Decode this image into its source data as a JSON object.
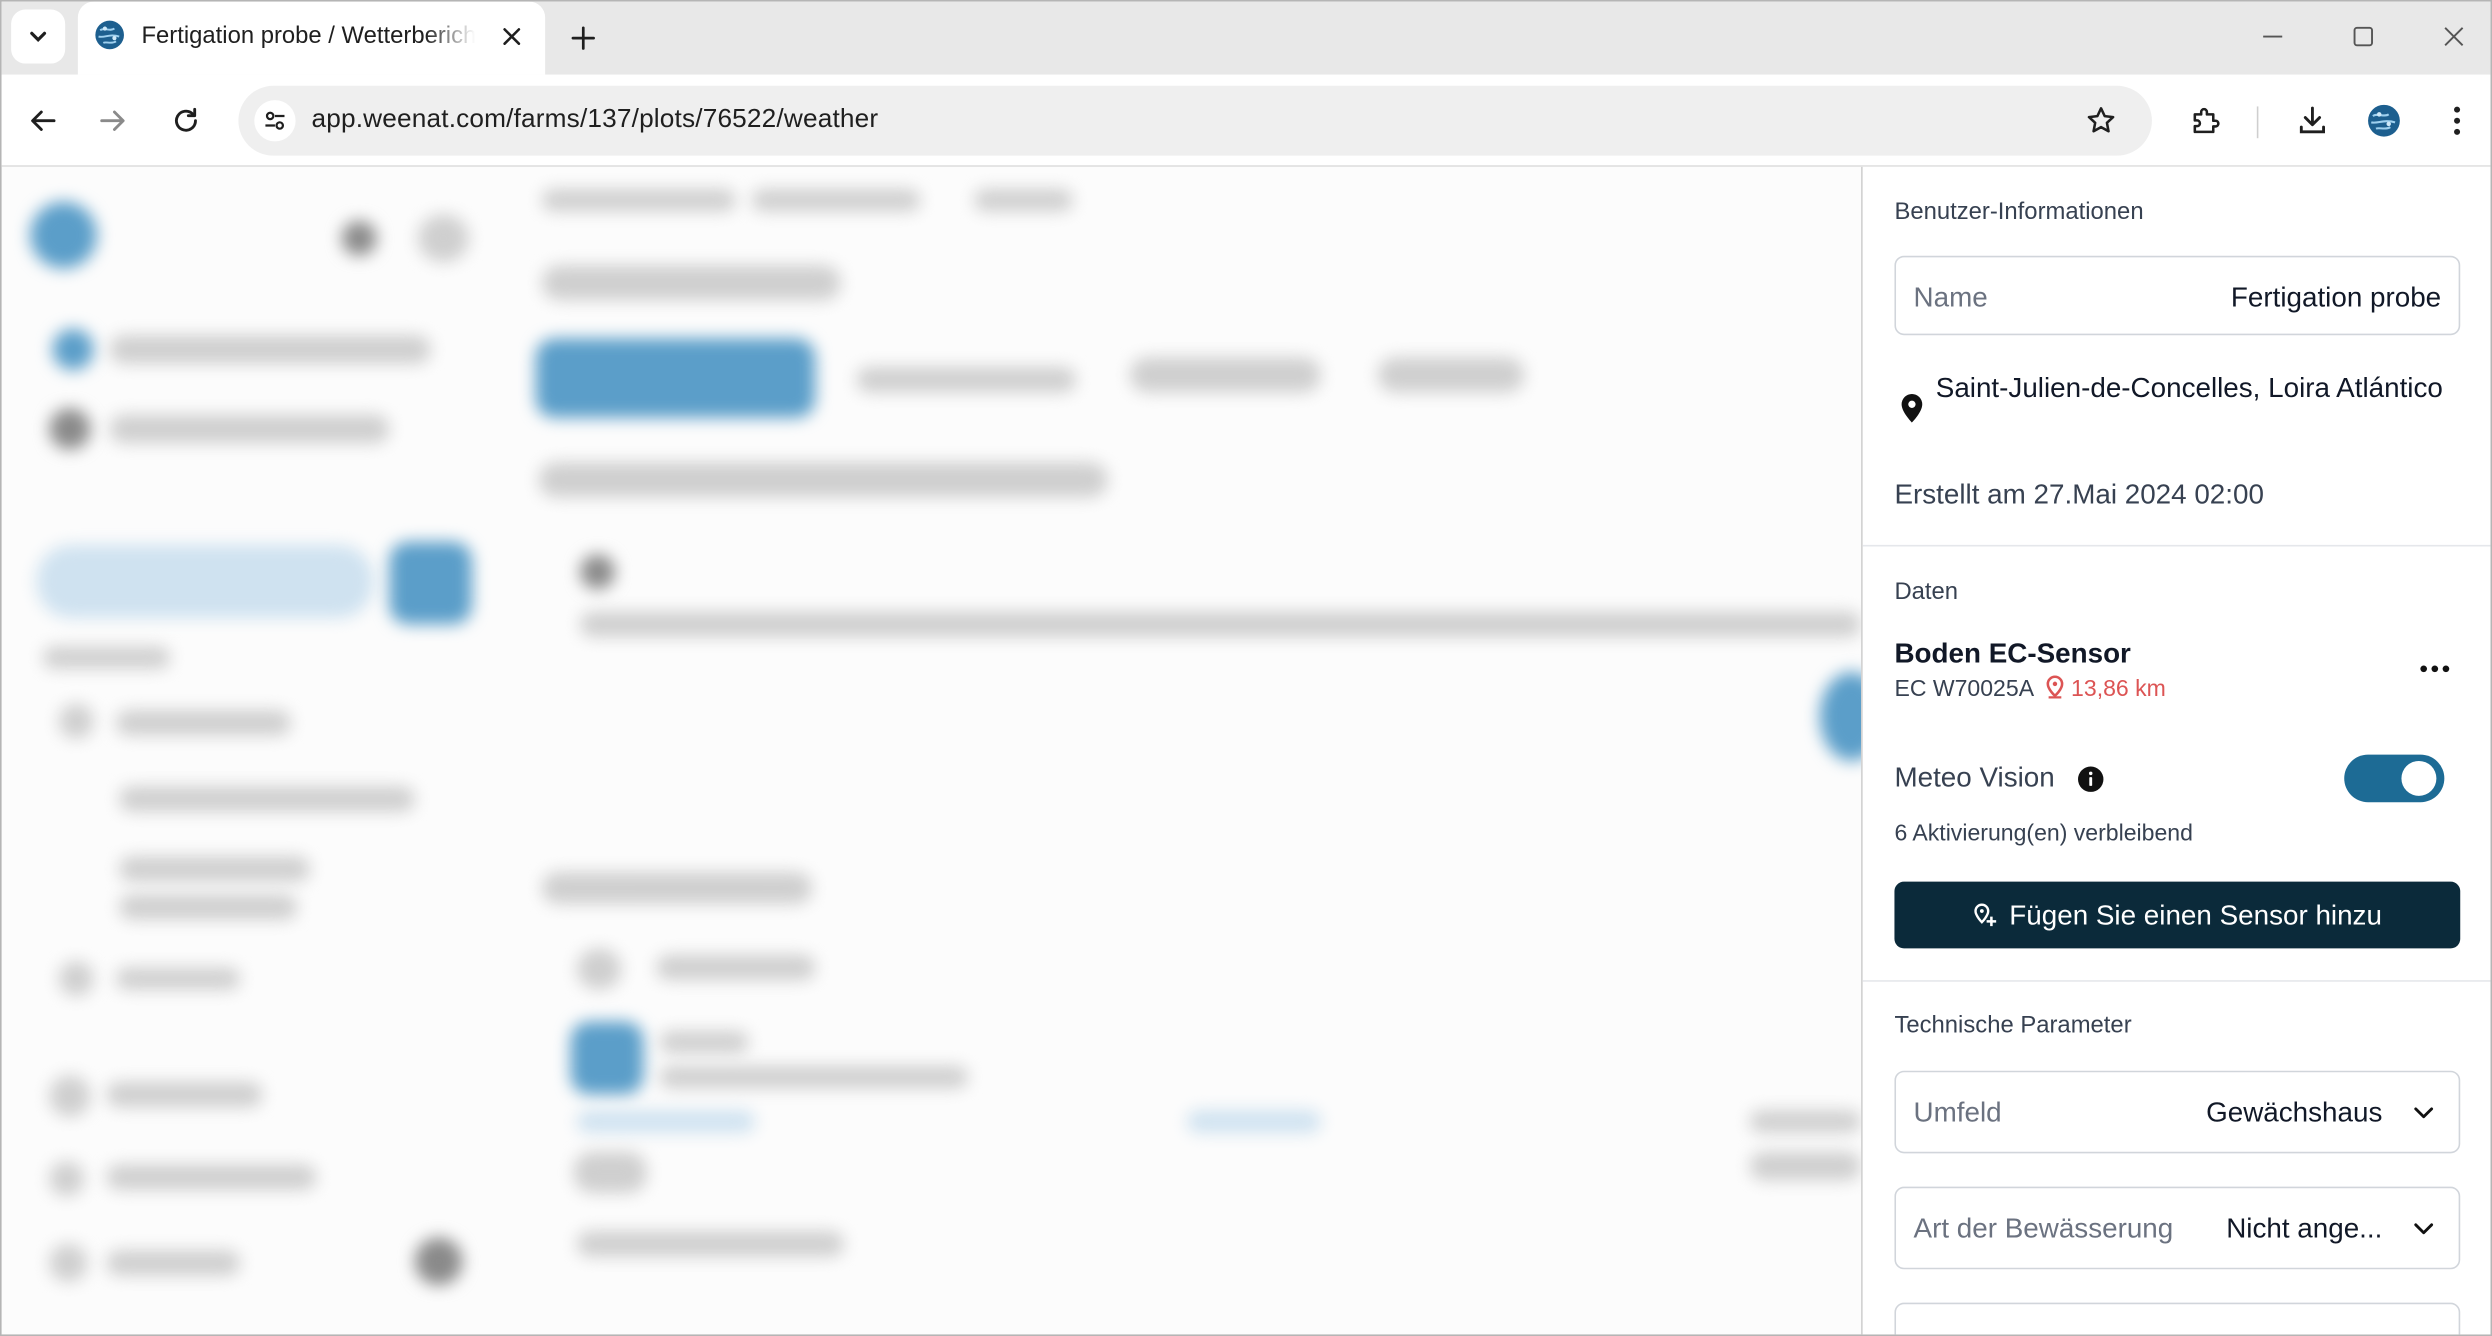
{
  "browser": {
    "tab_title": "Fertigation probe / Wetterbericht",
    "url": "app.weenat.com/farms/137/plots/76522/weather"
  },
  "panel": {
    "user_info_title": "Benutzer-Informationen",
    "name_label": "Name",
    "name_value": "Fertigation probe",
    "location": "Saint-Julien-de-Concelles, Loira Atlántico",
    "created": "Erstellt am 27.Mai 2024 02:00",
    "data_title": "Daten",
    "sensor": {
      "name": "Boden EC-Sensor",
      "id": "EC W70025A",
      "distance": "13,86 km"
    },
    "meteo_label": "Meteo Vision",
    "meteo_enabled": true,
    "activations": "6 Aktivierung(en) verbleibend",
    "add_sensor_label": "Fügen Sie einen Sensor hinzu",
    "tech_title": "Technische Parameter",
    "environment_label": "Umfeld",
    "environment_value": "Gewächshaus",
    "irrigation_label": "Art der Bewässerung",
    "irrigation_value": "Nicht ange..."
  },
  "colors": {
    "toggle_on": "#1d6b95",
    "primary_button": "#0b2a3a",
    "distance_text": "#dc5454"
  }
}
